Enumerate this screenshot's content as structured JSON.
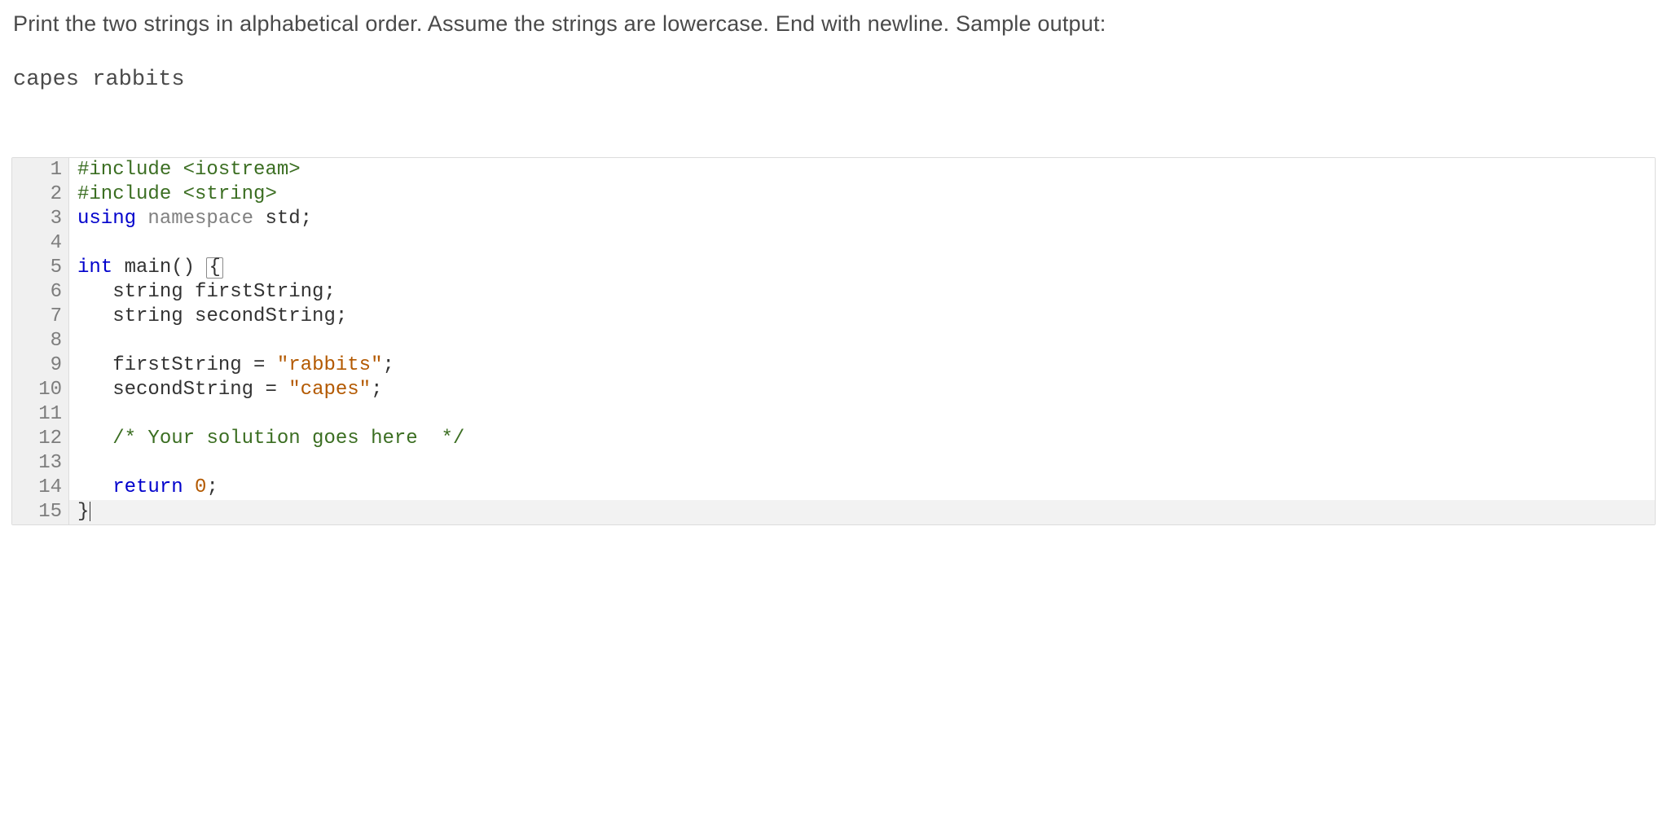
{
  "instructions": "Print the two strings in alphabetical order. Assume the strings are lowercase. End with newline. Sample output:",
  "sample_output": "capes rabbits",
  "code": {
    "lines": [
      {
        "n": "1",
        "tokens": [
          {
            "c": "tok-preproc",
            "t": "#include "
          },
          {
            "c": "tok-preproc-h",
            "t": "<iostream>"
          }
        ]
      },
      {
        "n": "2",
        "tokens": [
          {
            "c": "tok-preproc",
            "t": "#include "
          },
          {
            "c": "tok-preproc-h",
            "t": "<string>"
          }
        ]
      },
      {
        "n": "3",
        "tokens": [
          {
            "c": "tok-keyword",
            "t": "using"
          },
          {
            "c": "",
            "t": " "
          },
          {
            "c": "tok-keyword2",
            "t": "namespace"
          },
          {
            "c": "",
            "t": " "
          },
          {
            "c": "tok-ident",
            "t": "std"
          },
          {
            "c": "tok-punct",
            "t": ";"
          }
        ]
      },
      {
        "n": "4",
        "tokens": [
          {
            "c": "",
            "t": ""
          }
        ]
      },
      {
        "n": "5",
        "tokens": [
          {
            "c": "tok-type",
            "t": "int"
          },
          {
            "c": "",
            "t": " "
          },
          {
            "c": "tok-ident",
            "t": "main"
          },
          {
            "c": "tok-punct",
            "t": "() "
          },
          {
            "c": "cursor-box",
            "t": "{"
          }
        ]
      },
      {
        "n": "6",
        "tokens": [
          {
            "c": "",
            "t": "   "
          },
          {
            "c": "tok-ident",
            "t": "string firstString"
          },
          {
            "c": "tok-punct",
            "t": ";"
          }
        ]
      },
      {
        "n": "7",
        "tokens": [
          {
            "c": "",
            "t": "   "
          },
          {
            "c": "tok-ident",
            "t": "string secondString"
          },
          {
            "c": "tok-punct",
            "t": ";"
          }
        ]
      },
      {
        "n": "8",
        "tokens": [
          {
            "c": "",
            "t": ""
          }
        ]
      },
      {
        "n": "9",
        "tokens": [
          {
            "c": "",
            "t": "   "
          },
          {
            "c": "tok-ident",
            "t": "firstString "
          },
          {
            "c": "tok-punct",
            "t": "= "
          },
          {
            "c": "tok-string",
            "t": "\"rabbits\""
          },
          {
            "c": "tok-punct",
            "t": ";"
          }
        ]
      },
      {
        "n": "10",
        "tokens": [
          {
            "c": "",
            "t": "   "
          },
          {
            "c": "tok-ident",
            "t": "secondString "
          },
          {
            "c": "tok-punct",
            "t": "= "
          },
          {
            "c": "tok-string",
            "t": "\"capes\""
          },
          {
            "c": "tok-punct",
            "t": ";"
          }
        ]
      },
      {
        "n": "11",
        "tokens": [
          {
            "c": "",
            "t": ""
          }
        ]
      },
      {
        "n": "12",
        "tokens": [
          {
            "c": "",
            "t": "   "
          },
          {
            "c": "tok-comment",
            "t": "/* Your solution goes here  */"
          }
        ]
      },
      {
        "n": "13",
        "tokens": [
          {
            "c": "",
            "t": ""
          }
        ]
      },
      {
        "n": "14",
        "tokens": [
          {
            "c": "",
            "t": "   "
          },
          {
            "c": "tok-keyword",
            "t": "return"
          },
          {
            "c": "",
            "t": " "
          },
          {
            "c": "tok-number",
            "t": "0"
          },
          {
            "c": "tok-punct",
            "t": ";"
          }
        ]
      },
      {
        "n": "15",
        "tokens": [
          {
            "c": "tok-punct",
            "t": "}"
          },
          {
            "c": "caret",
            "t": ""
          }
        ],
        "active": true
      }
    ]
  }
}
